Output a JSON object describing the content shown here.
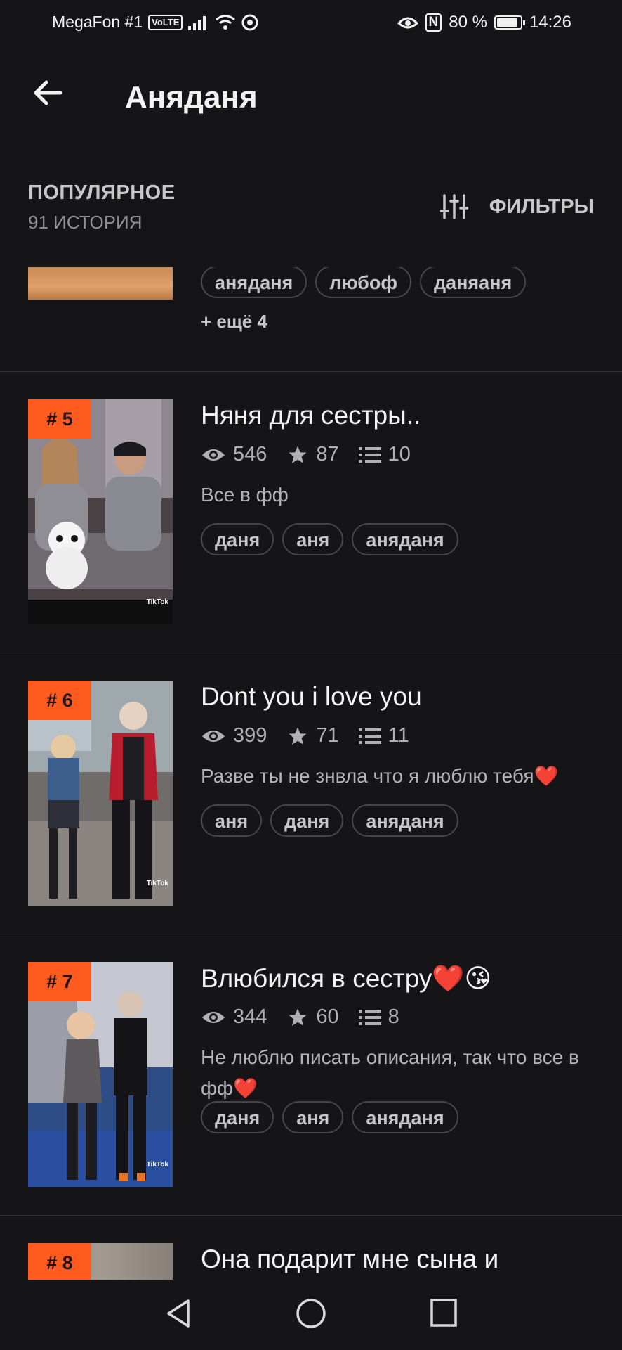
{
  "status_bar": {
    "carrier": "MegaFon #1",
    "volte": "VoLTE",
    "battery": "80 %",
    "time": "14:26",
    "nfc": "N"
  },
  "app_bar": {
    "title": "Аняданя"
  },
  "section": {
    "title": "ПОПУЛЯРНОЕ",
    "count": "91 ИСТОРИЯ",
    "filters_label": "ФИЛЬТРЫ"
  },
  "partial_story": {
    "tags": [
      "аняданя",
      "любоф",
      "даняаня"
    ],
    "more": "+ ещё 4"
  },
  "stories": [
    {
      "rank": "# 5",
      "title": "Няня для сестры..",
      "views": "546",
      "rating": "87",
      "parts": "10",
      "description": "Все в фф",
      "tags": [
        "даня",
        "аня",
        "аняданя"
      ],
      "cover_watermark": "TikTok"
    },
    {
      "rank": "# 6",
      "title": "Dont you i love you",
      "views": "399",
      "rating": "71",
      "parts": "11",
      "description": "Разве ты не знвла что я люблю тебя❤️",
      "tags": [
        "аня",
        "даня",
        "аняданя"
      ],
      "cover_watermark": "TikTok"
    },
    {
      "rank": "# 7",
      "title": "Влюбился в сестру❤️😘",
      "views": "344",
      "rating": "60",
      "parts": "8",
      "description": "Не люблю писать описания, так что все в фф❤️",
      "tags": [
        "даня",
        "аня",
        "аняданя"
      ],
      "cover_watermark": "TikTok"
    },
    {
      "rank": "# 8",
      "title": "Она подарит мне сына и"
    }
  ],
  "colors": {
    "accent": "#ff5b1f",
    "background": "#151417",
    "divider": "#333238"
  },
  "icons": [
    "back-arrow-icon",
    "filter-sliders-icon",
    "eye-icon",
    "star-icon",
    "list-icon",
    "nav-back-icon",
    "nav-home-icon",
    "nav-recents-icon"
  ]
}
